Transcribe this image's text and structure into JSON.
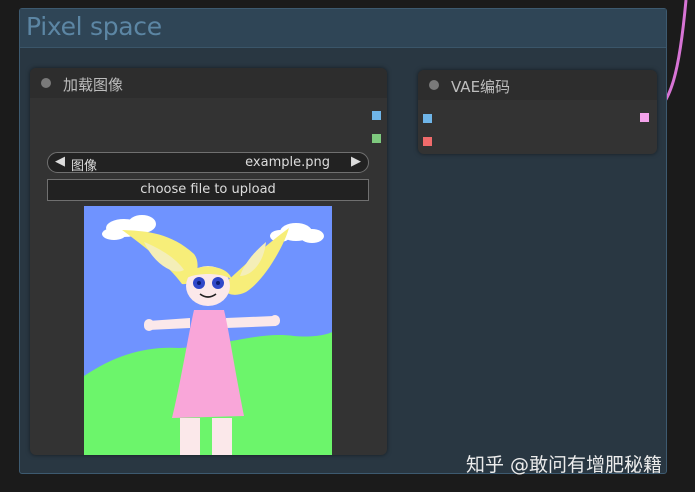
{
  "group": {
    "title": "Pixel space"
  },
  "load_image_node": {
    "title": "加载图像",
    "image_widget": {
      "label": "图像",
      "value": "example.png"
    },
    "upload_label": "choose file to upload",
    "ports": {
      "image_color": "#6fb5e8",
      "mask_color": "#7ec97e"
    }
  },
  "vae_encode_node": {
    "title": "VAE编码",
    "ports": {
      "pixels_color": "#6fb5e8",
      "vae_color": "#f06b6b",
      "latent_color": "#f3a2ea"
    }
  },
  "watermark": "知乎 @敢问有增肥秘籍",
  "colors": {
    "canvas": "#1b1b1b",
    "group": "#293742",
    "node": "#333333",
    "link_latent": "#d66fd6"
  }
}
